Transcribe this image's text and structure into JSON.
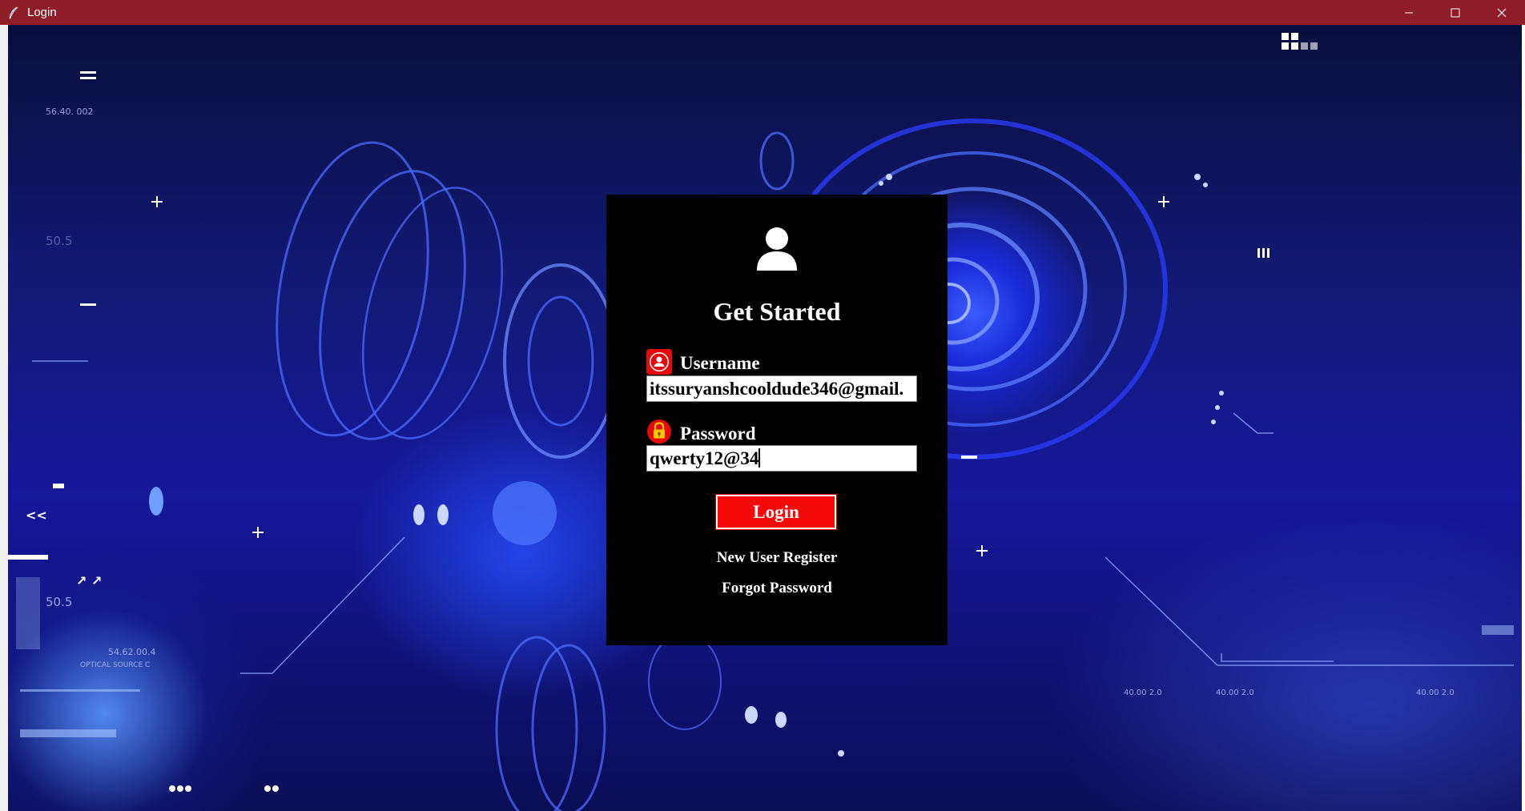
{
  "window": {
    "title": "Login",
    "icon": "feather-icon",
    "controls": [
      "minimize-icon",
      "maximize-icon",
      "close-icon"
    ]
  },
  "login": {
    "heading": "Get Started",
    "username_label": "Username",
    "username_value": "itssuryanshcooldude346@gmail.",
    "password_label": "Password",
    "password_value": "qwerty12@34",
    "login_button": "Login",
    "register_link": "New User Register",
    "forgot_link": "Forgot Password"
  },
  "background": {
    "readouts": [
      "56.40.  002",
      "50.5",
      "50.5",
      "54.62.00.4",
      "OPTICAL SOURCE C",
      "40.00  2.0",
      "40.00  2.0",
      "40.00  2.0"
    ]
  },
  "colors": {
    "titlebar": "#8f1d28",
    "accent_red": "#f50a0a",
    "panel": "#000000",
    "background_blue": "#1a2ad8"
  }
}
